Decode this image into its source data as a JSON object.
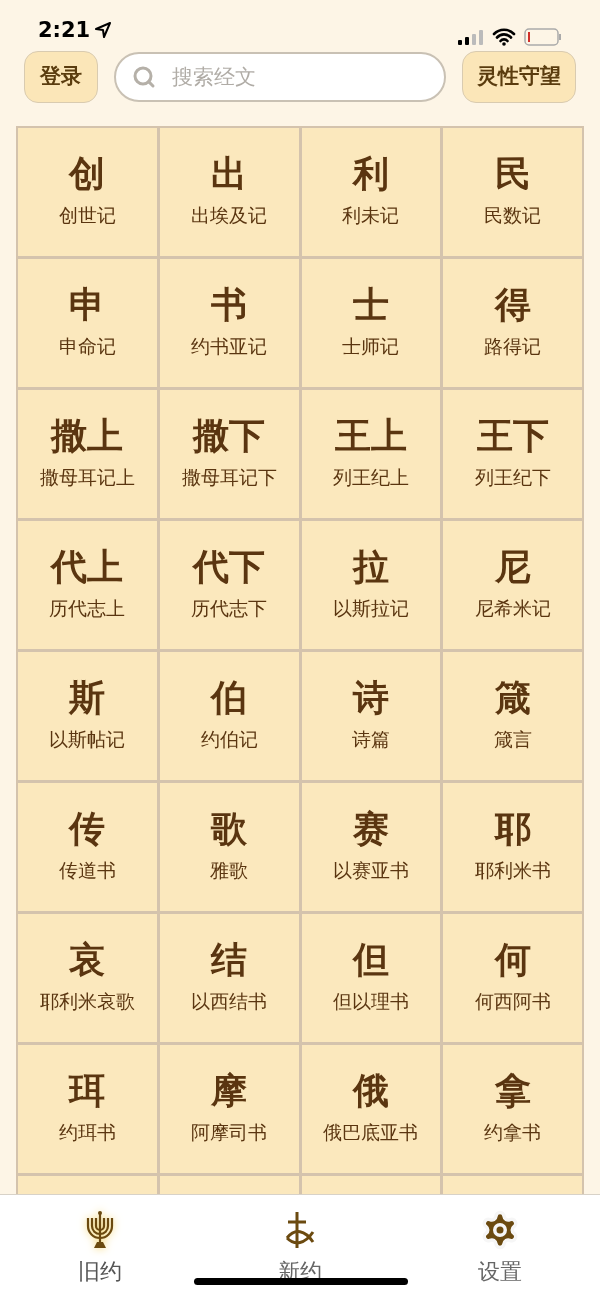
{
  "status_bar": {
    "time": "2:21"
  },
  "header": {
    "login_button": "登录",
    "search": {
      "placeholder": "搜索经文"
    },
    "right_button": "灵性守望"
  },
  "books": [
    {
      "short": "创",
      "name": "创世记"
    },
    {
      "short": "出",
      "name": "出埃及记"
    },
    {
      "short": "利",
      "name": "利未记"
    },
    {
      "short": "民",
      "name": "民数记"
    },
    {
      "short": "申",
      "name": "申命记"
    },
    {
      "short": "书",
      "name": "约书亚记"
    },
    {
      "short": "士",
      "name": "士师记"
    },
    {
      "short": "得",
      "name": "路得记"
    },
    {
      "short": "撒上",
      "name": "撒母耳记上"
    },
    {
      "short": "撒下",
      "name": "撒母耳记下"
    },
    {
      "short": "王上",
      "name": "列王纪上"
    },
    {
      "short": "王下",
      "name": "列王纪下"
    },
    {
      "short": "代上",
      "name": "历代志上"
    },
    {
      "short": "代下",
      "name": "历代志下"
    },
    {
      "short": "拉",
      "name": "以斯拉记"
    },
    {
      "short": "尼",
      "name": "尼希米记"
    },
    {
      "short": "斯",
      "name": "以斯帖记"
    },
    {
      "short": "伯",
      "name": "约伯记"
    },
    {
      "short": "诗",
      "name": "诗篇"
    },
    {
      "short": "箴",
      "name": "箴言"
    },
    {
      "short": "传",
      "name": "传道书"
    },
    {
      "short": "歌",
      "name": "雅歌"
    },
    {
      "short": "赛",
      "name": "以赛亚书"
    },
    {
      "short": "耶",
      "name": "耶利米书"
    },
    {
      "short": "哀",
      "name": "耶利米哀歌"
    },
    {
      "short": "结",
      "name": "以西结书"
    },
    {
      "short": "但",
      "name": "但以理书"
    },
    {
      "short": "何",
      "name": "何西阿书"
    },
    {
      "short": "珥",
      "name": "约珥书"
    },
    {
      "short": "摩",
      "name": "阿摩司书"
    },
    {
      "short": "俄",
      "name": "俄巴底亚书"
    },
    {
      "short": "拿",
      "name": "约拿书"
    }
  ],
  "tabs": [
    {
      "label": "旧约",
      "kind": "menorah",
      "selected": true
    },
    {
      "label": "新约",
      "kind": "cross",
      "selected": false
    },
    {
      "label": "设置",
      "kind": "gear",
      "selected": false
    }
  ]
}
